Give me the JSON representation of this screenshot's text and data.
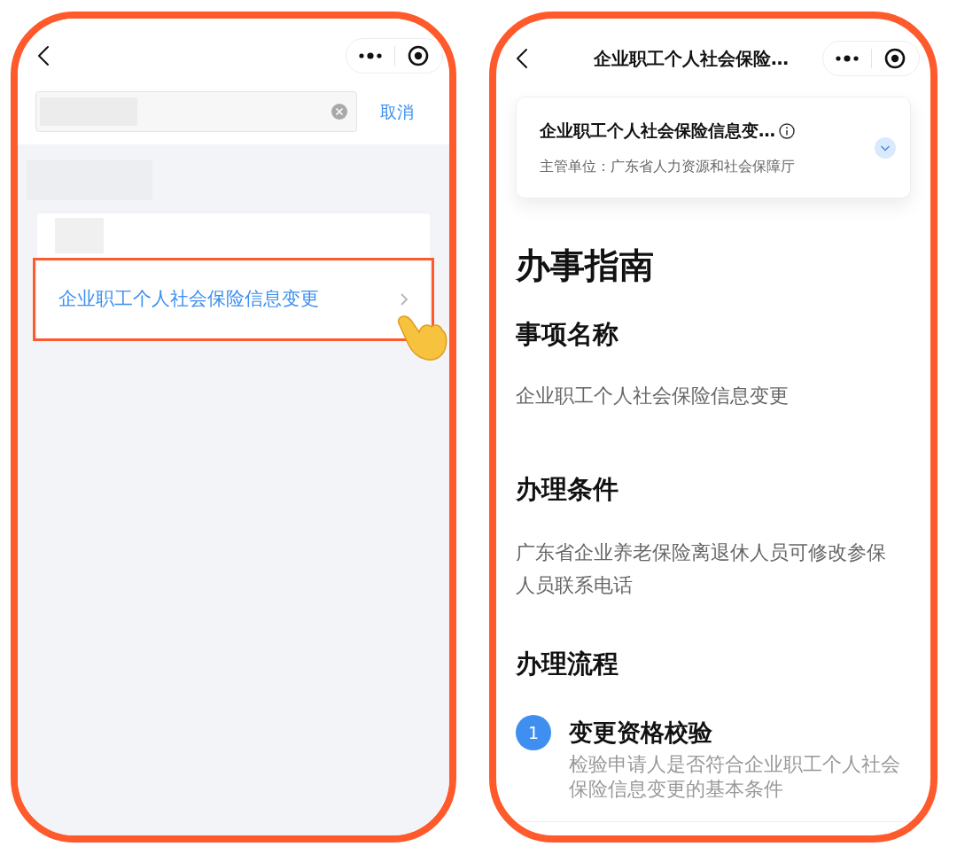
{
  "left_screen": {
    "search": {
      "cancel": "取消"
    },
    "results": [
      {
        "title": "企业职工个人社会保险信息变更",
        "highlighted": true
      }
    ]
  },
  "right_screen": {
    "title": "企业职工个人社会保险…",
    "card": {
      "title": "企业职工个人社会保险信息变…",
      "department": "主管单位：广东省人力资源和社会保障厅"
    },
    "heading": "办事指南",
    "sections": [
      {
        "kind": "text",
        "title": "事项名称",
        "text": "企业职工个人社会保险信息变更"
      },
      {
        "kind": "text",
        "title": "办理条件",
        "text": "广东省企业养老保险离退休人员可修改参保人员联系电话"
      },
      {
        "kind": "steps",
        "title": "办理流程",
        "steps": [
          {
            "number": "1",
            "title": "变更资格校验",
            "text": "检验申请人是否符合企业职工个人社会保险信息变更的基本条件"
          }
        ]
      }
    ]
  }
}
